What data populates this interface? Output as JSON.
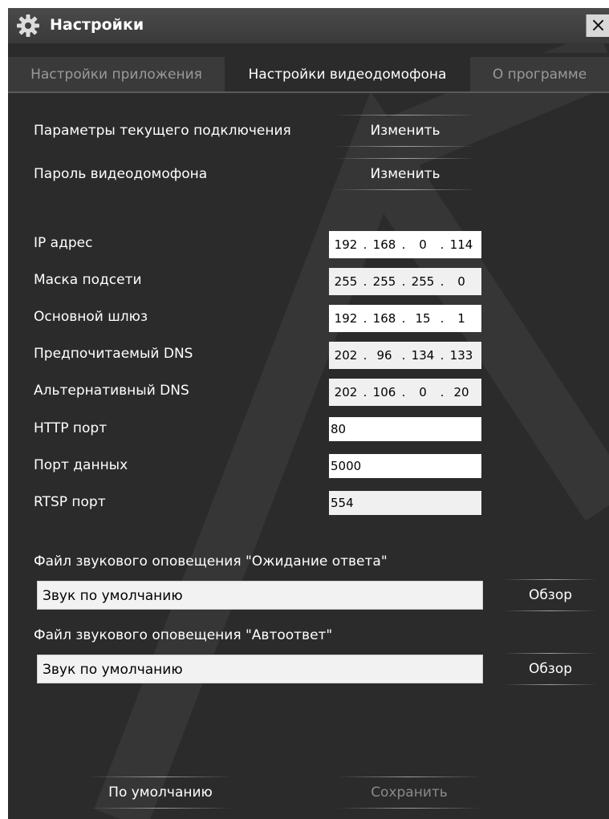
{
  "window": {
    "title": "Настройки",
    "close_label": "×"
  },
  "tabs": [
    {
      "label": "Настройки приложения",
      "active": false
    },
    {
      "label": "Настройки видеодомофона",
      "active": true
    },
    {
      "label": "О программе",
      "active": false
    }
  ],
  "connection": {
    "current_params_label": "Параметры текущего подключения",
    "current_params_button": "Изменить",
    "password_label": "Пароль видеодомофона",
    "password_button": "Изменить"
  },
  "network": {
    "ip": {
      "label": "IP адрес",
      "octets": [
        "192",
        "168",
        "0",
        "114"
      ]
    },
    "mask": {
      "label": "Маска подсети",
      "octets": [
        "255",
        "255",
        "255",
        "0"
      ]
    },
    "gateway": {
      "label": "Основной шлюз",
      "octets": [
        "192",
        "168",
        "15",
        "1"
      ]
    },
    "dns_primary": {
      "label": "Предпочитаемый DNS",
      "octets": [
        "202",
        "96",
        "134",
        "133"
      ]
    },
    "dns_alt": {
      "label": "Альтернативный DNS",
      "octets": [
        "202",
        "106",
        "0",
        "20"
      ]
    },
    "http_port": {
      "label": "HTTP порт",
      "value": "80"
    },
    "data_port": {
      "label": "Порт данных",
      "value": "5000"
    },
    "rtsp_port": {
      "label": "RTSP порт",
      "value": "554"
    }
  },
  "sounds": {
    "waiting_label": "Файл звукового оповещения \"Ожидание ответа\"",
    "waiting_value": "Звук по умолчанию",
    "autoanswer_label": "Файл звукового оповещения \"Автоответ\"",
    "autoanswer_value": "Звук по умолчанию",
    "browse_label": "Обзор"
  },
  "footer": {
    "defaults_button": "По умолчанию",
    "save_button": "Сохранить"
  },
  "colors": {
    "background": "#2b2b2b",
    "titlebar": "#3a3a3a",
    "text": "#ffffff",
    "disabled_text": "#8a8a8a"
  },
  "icons": {
    "settings": "gear-icon",
    "close": "close-icon"
  }
}
